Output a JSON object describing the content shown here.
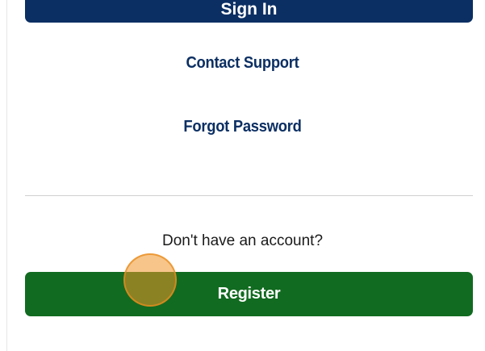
{
  "signin": {
    "label": "Sign In"
  },
  "links": {
    "contact_support": "Contact Support",
    "forgot_password": "Forgot Password"
  },
  "register_section": {
    "prompt": "Don't have an account?",
    "register_label": "Register"
  },
  "colors": {
    "primary_navy": "#0b2f63",
    "register_green": "#116b20",
    "tap_indicator": "#f09628"
  }
}
